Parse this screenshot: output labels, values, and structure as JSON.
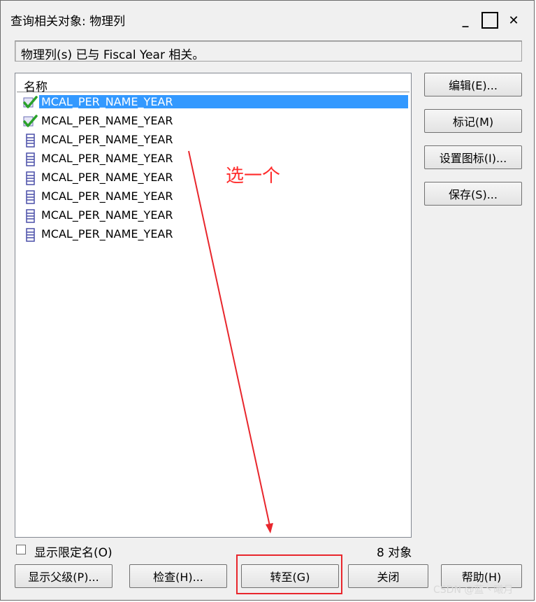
{
  "window": {
    "title": "查询相关对象: 物理列"
  },
  "titlebar_buttons": {
    "minimize": "_",
    "maximize": "",
    "close": "✕"
  },
  "status": {
    "text": "物理列(s) 已与 Fiscal Year 相关。"
  },
  "list": {
    "column_header": "名称",
    "rows": [
      {
        "label": "MCAL_PER_NAME_YEAR",
        "icon": "checkmark-icon",
        "selected": true
      },
      {
        "label": "MCAL_PER_NAME_YEAR",
        "icon": "checkmark-icon",
        "selected": false
      },
      {
        "label": "MCAL_PER_NAME_YEAR",
        "icon": "column-icon",
        "selected": false
      },
      {
        "label": "MCAL_PER_NAME_YEAR",
        "icon": "column-icon",
        "selected": false
      },
      {
        "label": "MCAL_PER_NAME_YEAR",
        "icon": "column-icon",
        "selected": false
      },
      {
        "label": "MCAL_PER_NAME_YEAR",
        "icon": "column-icon",
        "selected": false
      },
      {
        "label": "MCAL_PER_NAME_YEAR",
        "icon": "column-icon",
        "selected": false
      },
      {
        "label": "MCAL_PER_NAME_YEAR",
        "icon": "column-icon",
        "selected": false
      }
    ]
  },
  "side_buttons": {
    "edit": "编辑(E)...",
    "mark": "标记(M)",
    "set_icon": "设置图标(I)...",
    "save": "保存(S)..."
  },
  "options": {
    "show_qualified_name": "显示限定名(O)",
    "show_qualified_name_checked": false
  },
  "object_count": "8 对象",
  "bottom_buttons": {
    "show_parent": "显示父级(P)...",
    "inspect": "检查(H)...",
    "goto": "转至(G)",
    "close": "关闭",
    "help": "帮助(H)"
  },
  "annotation": {
    "text": "选一个",
    "color": "#ff2b2b"
  },
  "watermark": "CSDN @蓝丶曦月",
  "colors": {
    "selection": "#3399ff",
    "annotation": "#e8262c",
    "check": "#2aa12a",
    "column_icon": "#4a4fa8"
  }
}
